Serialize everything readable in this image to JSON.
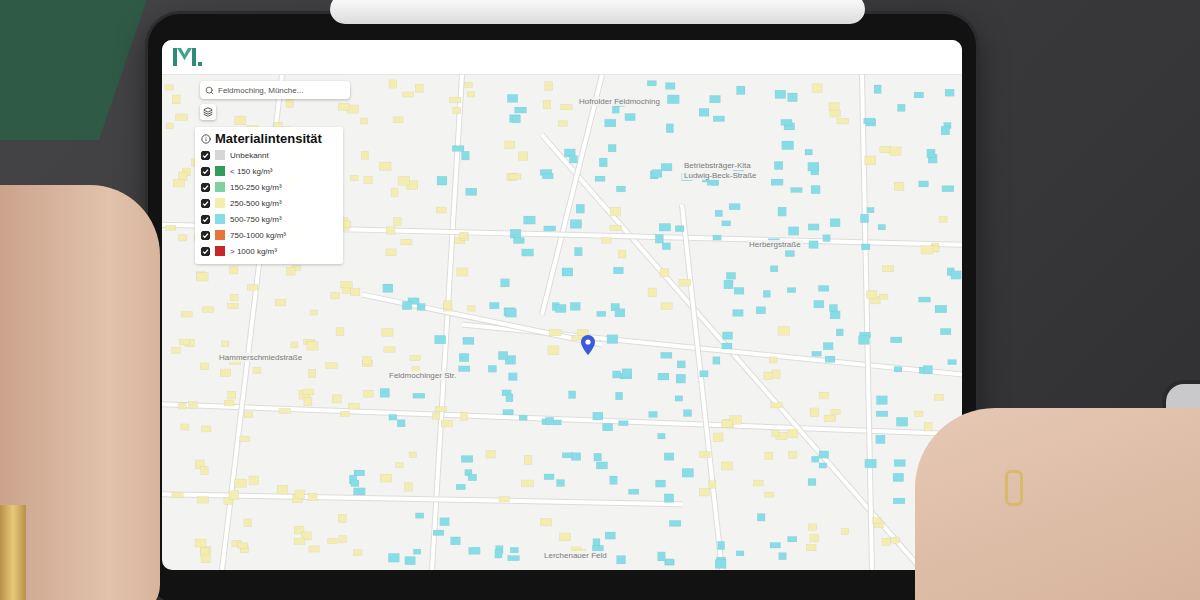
{
  "search": {
    "placeholder": "Feldmoching, Münche..."
  },
  "legend": {
    "title": "Materialintensität",
    "items": [
      {
        "label": "Unbekannt",
        "checked": true,
        "color": "#d6d6d6"
      },
      {
        "label": "< 150 kg/m³",
        "checked": true,
        "color": "#2e9e5b"
      },
      {
        "label": "150-250 kg/m³",
        "checked": true,
        "color": "#7fd1a0"
      },
      {
        "label": "250-500 kg/m³",
        "checked": true,
        "color": "#f3eeb0"
      },
      {
        "label": "500-750 kg/m³",
        "checked": true,
        "color": "#86dde8"
      },
      {
        "label": "750-1000 kg/m³",
        "checked": true,
        "color": "#e8743b"
      },
      {
        "label": "> 1000 kg/m³",
        "checked": true,
        "color": "#c62828"
      }
    ]
  },
  "map": {
    "labels": [
      {
        "text": "Hofrolder Feldmoching"
      },
      {
        "text": "Betriebsträger-Kita"
      },
      {
        "text": "Ludwig-Beck-Straße"
      },
      {
        "text": "Herbergstraße"
      },
      {
        "text": "Feldmochinger Str."
      },
      {
        "text": "Hammerschmiedstraße"
      },
      {
        "text": "Lerchenauer Feld"
      }
    ],
    "buildings": [
      {
        "color": "#f3eeb0"
      },
      {
        "color": "#f3eeb0"
      },
      {
        "color": "#f3eeb0"
      },
      {
        "color": "#f3eeb0"
      },
      {
        "color": "#f3eeb0"
      },
      {
        "color": "#f3eeb0"
      },
      {
        "color": "#86dde8"
      },
      {
        "color": "#f3eeb0"
      },
      {
        "color": "#86dde8"
      },
      {
        "color": "#86dde8"
      },
      {
        "color": "#86dde8"
      },
      {
        "color": "#86dde8"
      },
      {
        "color": "#f3eeb0"
      },
      {
        "color": "#86dde8"
      },
      {
        "color": "#86dde8"
      },
      {
        "color": "#f3eeb0"
      },
      {
        "color": "#f3eeb0"
      },
      {
        "color": "#f3eeb0"
      },
      {
        "color": "#f3eeb0"
      },
      {
        "color": "#f3eeb0"
      },
      {
        "color": "#86dde8"
      },
      {
        "color": "#f3eeb0"
      },
      {
        "color": "#86dde8"
      },
      {
        "color": "#86dde8"
      },
      {
        "color": "#86dde8"
      },
      {
        "color": "#86dde8"
      },
      {
        "color": "#86dde8"
      },
      {
        "color": "#86dde8"
      },
      {
        "color": "#f3eeb0"
      },
      {
        "color": "#86dde8"
      },
      {
        "color": "#f3eeb0"
      },
      {
        "color": "#f3eeb0"
      },
      {
        "color": "#f3eeb0"
      },
      {
        "color": "#f3eeb0"
      },
      {
        "color": "#f3eeb0"
      },
      {
        "color": "#f3eeb0"
      },
      {
        "color": "#86dde8"
      },
      {
        "color": "#86dde8"
      },
      {
        "color": "#f3eeb0"
      },
      {
        "color": "#86dde8"
      },
      {
        "color": "#86dde8"
      },
      {
        "color": "#86dde8"
      },
      {
        "color": "#86dde8"
      },
      {
        "color": "#86dde8"
      },
      {
        "color": "#f3eeb0"
      },
      {
        "color": "#f3eeb0"
      },
      {
        "color": "#f3eeb0"
      },
      {
        "color": "#f3eeb0"
      },
      {
        "color": "#f3eeb0"
      },
      {
        "color": "#86dde8"
      },
      {
        "color": "#f3eeb0"
      },
      {
        "color": "#86dde8"
      },
      {
        "color": "#86dde8"
      },
      {
        "color": "#86dde8"
      },
      {
        "color": "#f3eeb0"
      },
      {
        "color": "#86dde8"
      },
      {
        "color": "#86dde8"
      },
      {
        "color": "#86dde8"
      },
      {
        "color": "#f3eeb0"
      },
      {
        "color": "#86dde8"
      },
      {
        "color": "#f3eeb0"
      },
      {
        "color": "#f3eeb0"
      },
      {
        "color": "#f3eeb0"
      },
      {
        "color": "#f3eeb0"
      },
      {
        "color": "#f3eeb0"
      },
      {
        "color": "#86dde8"
      },
      {
        "color": "#86dde8"
      },
      {
        "color": "#f3eeb0"
      },
      {
        "color": "#86dde8"
      },
      {
        "color": "#86dde8"
      },
      {
        "color": "#86dde8"
      },
      {
        "color": "#f3eeb0"
      },
      {
        "color": "#86dde8"
      },
      {
        "color": "#86dde8"
      },
      {
        "color": "#86dde8"
      },
      {
        "color": "#f3eeb0"
      },
      {
        "color": "#f3eeb0"
      },
      {
        "color": "#f3eeb0"
      },
      {
        "color": "#f3eeb0"
      },
      {
        "color": "#86dde8"
      },
      {
        "color": "#f3eeb0"
      },
      {
        "color": "#86dde8"
      },
      {
        "color": "#86dde8"
      },
      {
        "color": "#86dde8"
      },
      {
        "color": "#86dde8"
      },
      {
        "color": "#f3eeb0"
      },
      {
        "color": "#f3eeb0"
      },
      {
        "color": "#f3eeb0"
      },
      {
        "color": "#86dde8"
      },
      {
        "color": "#f3eeb0"
      },
      {
        "color": "#f3eeb0"
      },
      {
        "color": "#f3eeb0"
      },
      {
        "color": "#f3eeb0"
      },
      {
        "color": "#86dde8"
      },
      {
        "color": "#f3eeb0"
      },
      {
        "color": "#86dde8"
      },
      {
        "color": "#f3eeb0"
      },
      {
        "color": "#86dde8"
      },
      {
        "color": "#86dde8"
      },
      {
        "color": "#86dde8"
      },
      {
        "color": "#f3eeb0"
      },
      {
        "color": "#f3eeb0"
      },
      {
        "color": "#86dde8"
      },
      {
        "color": "#86dde8"
      },
      {
        "color": "#86dde8"
      },
      {
        "color": "#f3eeb0"
      },
      {
        "color": "#f3eeb0"
      },
      {
        "color": "#f3eeb0"
      },
      {
        "color": "#f3eeb0"
      },
      {
        "color": "#86dde8"
      },
      {
        "color": "#86dde8"
      },
      {
        "color": "#86dde8"
      },
      {
        "color": "#f3eeb0"
      },
      {
        "color": "#86dde8"
      },
      {
        "color": "#86dde8"
      },
      {
        "color": "#86dde8"
      },
      {
        "color": "#86dde8"
      },
      {
        "color": "#f3eeb0"
      },
      {
        "color": "#f3eeb0"
      },
      {
        "color": "#86dde8"
      }
    ]
  }
}
